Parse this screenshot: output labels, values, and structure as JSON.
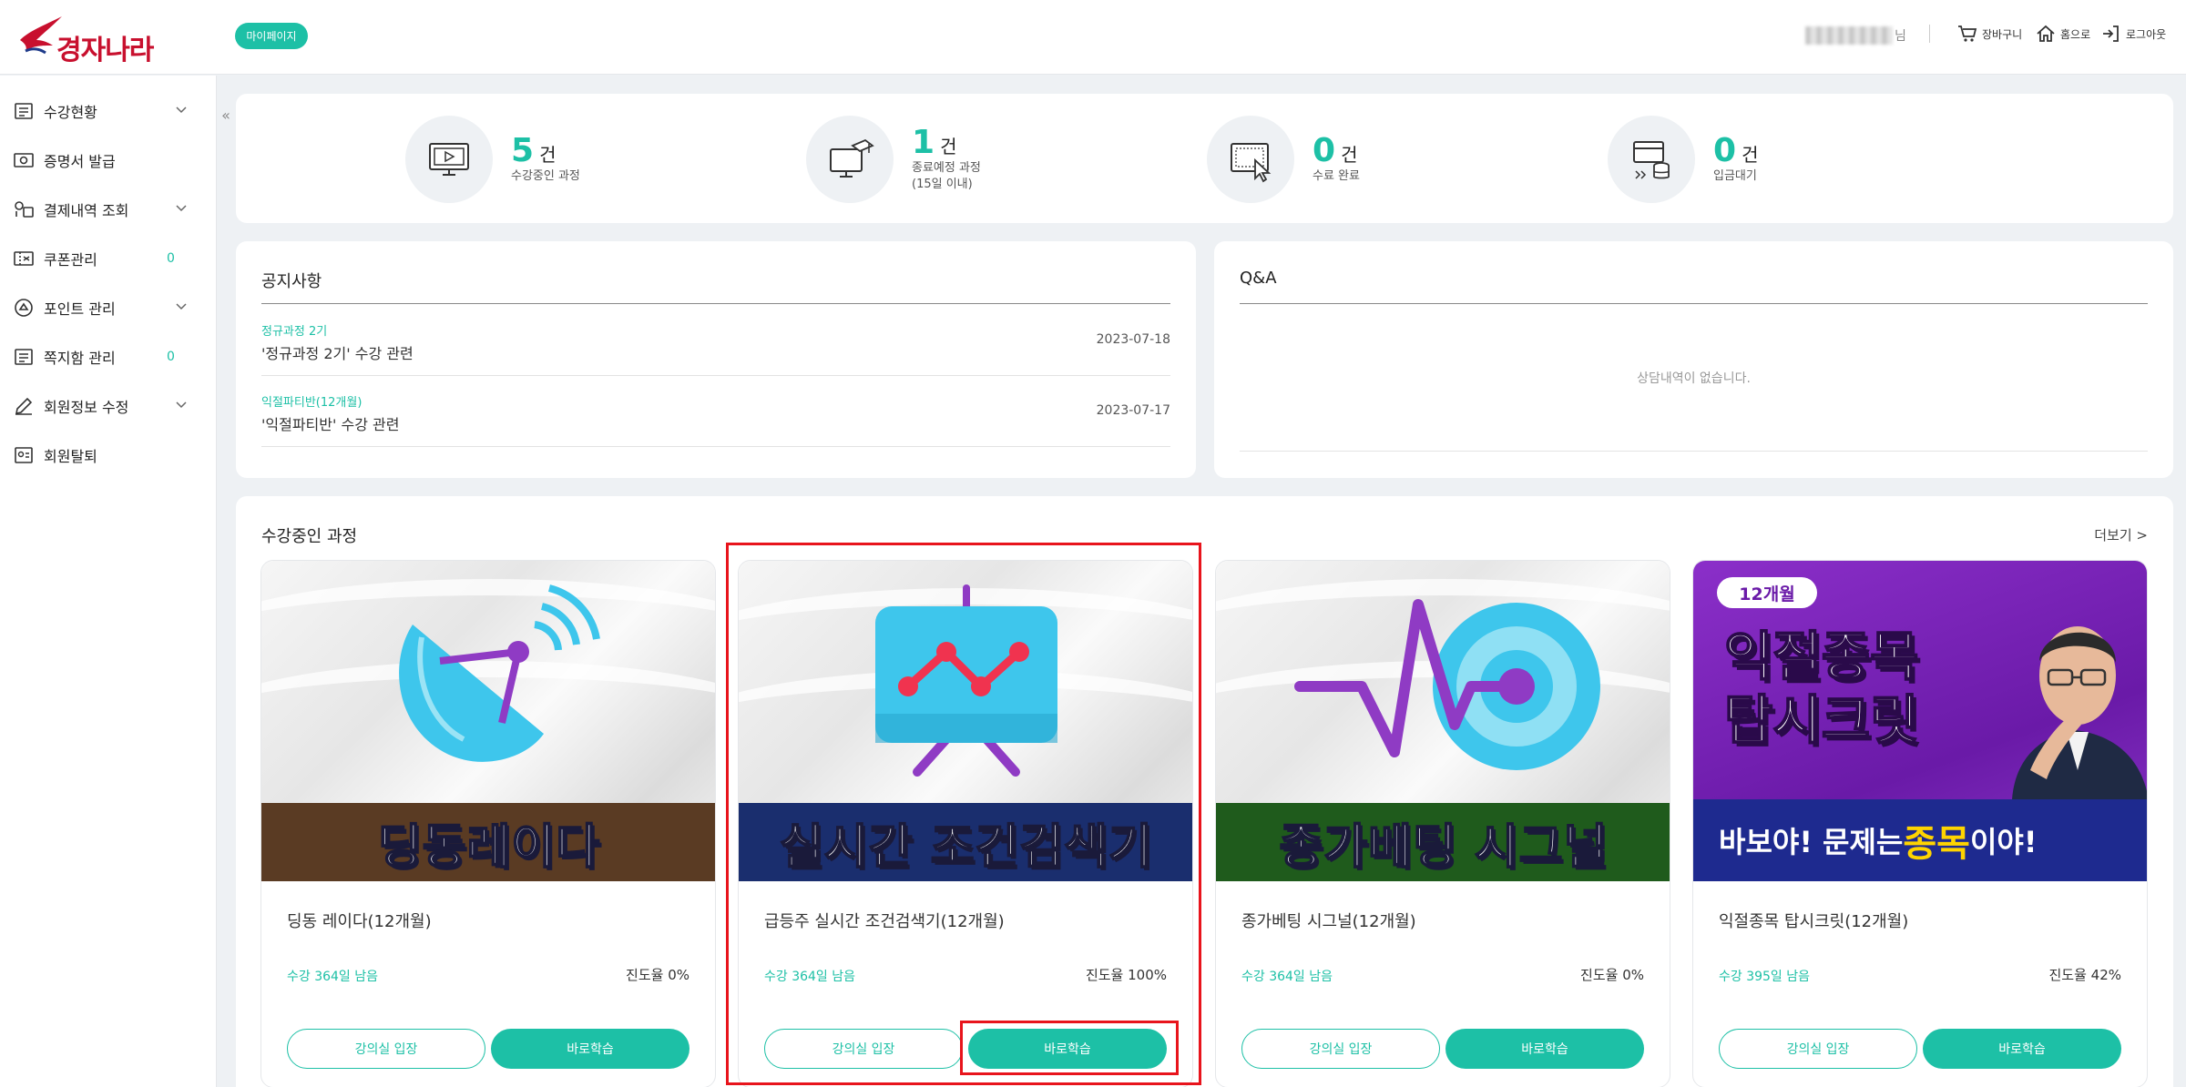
{
  "header": {
    "logo_text": "경자나라",
    "mypage_label": "마이페이지",
    "user_suffix": "님",
    "cart_label": "장바구니",
    "home_label": "홈으로",
    "logout_label": "로그아웃"
  },
  "sidebar": {
    "collapse_label": "«",
    "items": [
      {
        "label": "수강현황",
        "icon": "list-icon",
        "has_submenu": true
      },
      {
        "label": "증명서 발급",
        "icon": "certificate-icon",
        "has_submenu": false
      },
      {
        "label": "결제내역 조회",
        "icon": "payment-icon",
        "has_submenu": true
      },
      {
        "label": "쿠폰관리",
        "icon": "coupon-icon",
        "has_submenu": false,
        "count": "0"
      },
      {
        "label": "포인트 관리",
        "icon": "point-icon",
        "has_submenu": true
      },
      {
        "label": "쪽지함 관리",
        "icon": "message-icon",
        "has_submenu": false,
        "count": "0"
      },
      {
        "label": "회원정보 수정",
        "icon": "pencil-icon",
        "has_submenu": true
      },
      {
        "label": "회원탈퇴",
        "icon": "withdraw-icon",
        "has_submenu": false
      }
    ]
  },
  "stats": [
    {
      "count": "5",
      "unit": "건",
      "label": "수강중인 과정",
      "icon": "monitor-play-icon"
    },
    {
      "count": "1",
      "unit": "건",
      "label": "종료예정 과정\n(15일 이내)",
      "icon": "graduation-monitor-icon"
    },
    {
      "count": "0",
      "unit": "건",
      "label": "수료 완료",
      "icon": "certificate-click-icon"
    },
    {
      "count": "0",
      "unit": "건",
      "label": "입금대기",
      "icon": "card-coins-icon"
    }
  ],
  "notice": {
    "title": "공지사항",
    "items": [
      {
        "category": "정규과정 2기",
        "title": "'정규과정 2기' 수강 관련",
        "date": "2023-07-18"
      },
      {
        "category": "익절파티반(12개월)",
        "title": "'익절파티반' 수강 관련",
        "date": "2023-07-17"
      }
    ]
  },
  "qa": {
    "title": "Q&A",
    "empty_text": "상담내역이 없습니다."
  },
  "courses": {
    "title": "수강중인 과정",
    "more_label": "더보기 >",
    "enter_label": "강의실 입장",
    "study_label": "바로학습",
    "items": [
      {
        "banner": "딩동레이다",
        "banner_color": "#5a3b23",
        "title": "딩동 레이다(12개월)",
        "remain": "수강 364일 남음",
        "progress": "진도율 0%"
      },
      {
        "banner": "실시간 조건검색기",
        "banner_color": "#1a2e6e",
        "title": "급등주 실시간 조건검색기(12개월)",
        "remain": "수강 364일 남음",
        "progress": "진도율 100%"
      },
      {
        "banner": "종가베팅 시그널",
        "banner_color": "#1f5b1c",
        "title": "종가베팅 시그널(12개월)",
        "remain": "수강 364일 남음",
        "progress": "진도율 0%"
      },
      {
        "promo_tag": "12개월",
        "promo_title": "익절종목\n탑시크릿",
        "promo_sub_a": "바보야! 문제는 ",
        "promo_sub_hl": "종목",
        "promo_sub_b": "이야!",
        "title": "익절종목 탑시크릿(12개월)",
        "remain": "수강 395일 남음",
        "progress": "진도율 42%"
      }
    ]
  },
  "colors": {
    "accent": "#1dc0a6",
    "highlight": "#e8141c"
  }
}
